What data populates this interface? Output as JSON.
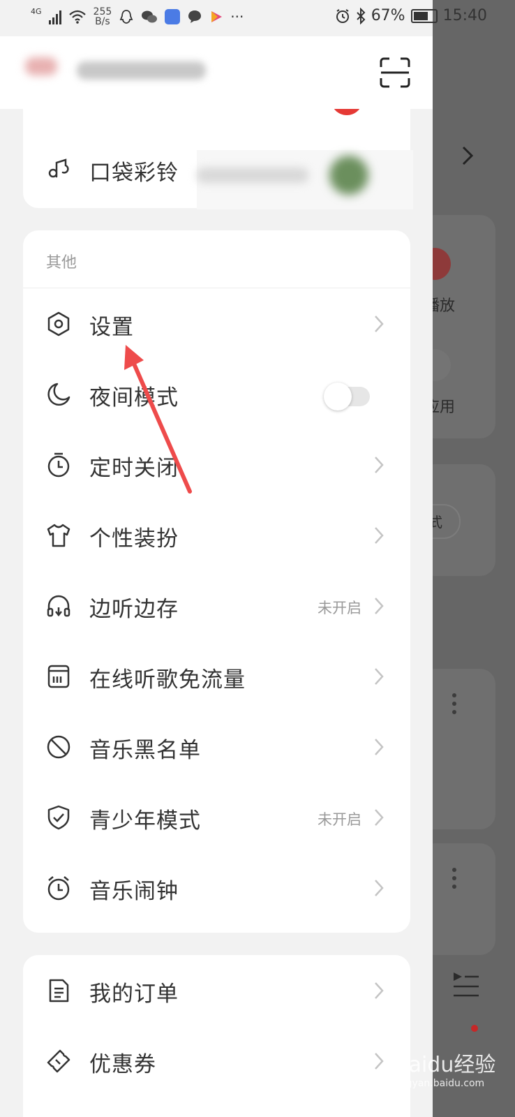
{
  "status_bar": {
    "network": "4G",
    "speed_value": "255",
    "speed_unit": "B/s",
    "more": "···",
    "battery": "67%",
    "time": "15:40"
  },
  "header": {
    "scan_icon": "scan-icon"
  },
  "top_card": {
    "items": [
      {
        "label": "口袋彩铃",
        "icon": "ringtone-icon"
      }
    ]
  },
  "other_section": {
    "title": "其他",
    "items": [
      {
        "label": "设置",
        "icon": "settings-hexagon-icon"
      },
      {
        "label": "夜间模式",
        "icon": "moon-icon",
        "toggle_on": false
      },
      {
        "label": "定时关闭",
        "icon": "timer-icon"
      },
      {
        "label": "个性装扮",
        "icon": "tshirt-icon"
      },
      {
        "label": "边听边存",
        "icon": "headphones-icon",
        "status": "未开启"
      },
      {
        "label": "在线听歌免流量",
        "icon": "sim-card-icon"
      },
      {
        "label": "音乐黑名单",
        "icon": "block-icon"
      },
      {
        "label": "青少年模式",
        "icon": "shield-check-icon",
        "status": "未开启"
      },
      {
        "label": "音乐闹钟",
        "icon": "alarm-clock-icon"
      }
    ]
  },
  "bottom_card": {
    "items": [
      {
        "label": "我的订单",
        "icon": "order-icon"
      },
      {
        "label": "优惠券",
        "icon": "coupon-icon"
      }
    ]
  },
  "background_app": {
    "text_1": "播放",
    "text_2": "应用",
    "text_3": "模式"
  },
  "watermark": {
    "text": "Baidu经验",
    "sub": "jingyan.baidu.com"
  },
  "colors": {
    "annotation_arrow": "#ee4b4b",
    "toggle_off": "#e6e6e6",
    "red_badge": "#e53935"
  }
}
